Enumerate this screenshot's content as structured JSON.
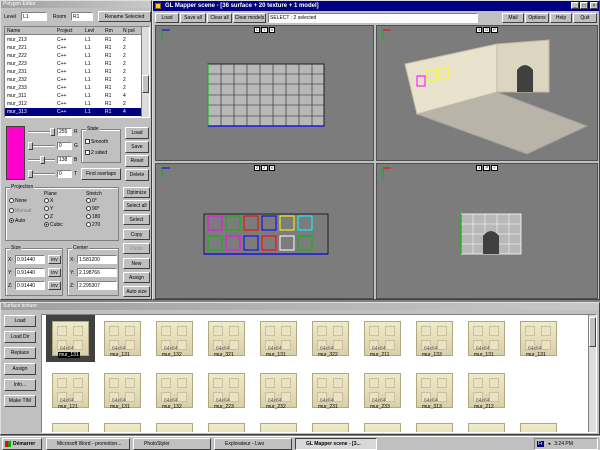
{
  "polygon_window": {
    "title": "Polygon Editor",
    "level_label": "Level",
    "level_value": "L1",
    "room_label": "Room",
    "room_value": "R1",
    "rename_button": "Rename Selected",
    "columns": [
      "Name",
      "Project",
      "Levl",
      "Rm",
      "N pol"
    ],
    "rows": [
      [
        "mur_213",
        "C++",
        "L1",
        "R1",
        "2"
      ],
      [
        "mur_221",
        "C++",
        "L1",
        "R1",
        "2"
      ],
      [
        "mur_222",
        "C++",
        "L1",
        "R1",
        "2"
      ],
      [
        "mur_223",
        "C++",
        "L1",
        "R1",
        "2"
      ],
      [
        "mur_231",
        "C++",
        "L1",
        "R1",
        "2"
      ],
      [
        "mur_232",
        "C++",
        "L1",
        "R1",
        "2"
      ],
      [
        "mur_233",
        "C++",
        "L1",
        "R1",
        "2"
      ],
      [
        "mur_311",
        "C++",
        "L1",
        "R1",
        "4"
      ],
      [
        "mur_312",
        "C++",
        "L1",
        "R1",
        "2"
      ],
      [
        "mur_313",
        "C++",
        "L1",
        "R1",
        "4"
      ]
    ],
    "selected_row_index": 9,
    "color_sliders": [
      {
        "value": "255",
        "channel": "R"
      },
      {
        "value": "0",
        "channel": "G"
      },
      {
        "value": "138",
        "channel": "B"
      },
      {
        "value": "0",
        "channel": "T"
      }
    ],
    "color_swatch": "#ff00cc",
    "state_group": "State",
    "smooth_label": "Smooth",
    "two_sided_label": "2 sided",
    "find_overlaps_button": "Find overlaps",
    "side_buttons": [
      "Load",
      "Save",
      "Reset",
      "Delete"
    ],
    "projection": {
      "title": "Projection",
      "options": [
        "None",
        "Manual",
        "Auto"
      ],
      "selected": "Auto",
      "plane_title": "Plane",
      "plane_options": [
        "X",
        "Y",
        "Z",
        "Cubic"
      ],
      "plane_selected": "Cubic",
      "stretch_title": "Stretch",
      "stretch_options": [
        "0°",
        "90°",
        "180",
        "270"
      ]
    },
    "optimize_buttons": [
      "Optimize",
      "Select all",
      "Select",
      "Copy",
      "Paste",
      "New",
      "Assign",
      "Auto size"
    ],
    "size": {
      "title": "Size",
      "x": "0.91440",
      "y": "0.91440",
      "z": "0.91440",
      "inv": "inv"
    },
    "center": {
      "title": "Center",
      "x": "1.581200",
      "y": "2.198766",
      "z": "2.295307"
    }
  },
  "scene_window": {
    "title": "GL Mapper scene - [36 surface + 20 texture + 1 model]",
    "toolbar": [
      "Load",
      "Save all",
      "Clear all",
      "Clear models"
    ],
    "status": "SELECT : 2 selected",
    "menu": [
      "Mail",
      "Options",
      "Help",
      "Quit"
    ],
    "viewports": [
      {
        "label": "1",
        "axis_a": "Y",
        "axis_b": "X"
      },
      {
        "label": "3",
        "axis_a": "D",
        "axis_b": "P"
      },
      {
        "label": "2",
        "axis_a": "Z",
        "axis_b": "X"
      },
      {
        "label": "4",
        "axis_a": "P",
        "axis_b": "Y"
      }
    ]
  },
  "surface_window": {
    "title": "Surface texture",
    "buttons": [
      "Load",
      "Load Dir",
      "Replace",
      "Assign",
      "Info...",
      "Make TIM"
    ],
    "row1": [
      {
        "size": "64x64",
        "name": "mur_131",
        "selected": true
      },
      {
        "size": "64x64",
        "name": "mur_131"
      },
      {
        "size": "64x64",
        "name": "mur_132"
      },
      {
        "size": "64x64",
        "name": "mur_321"
      },
      {
        "size": "64x64",
        "name": "mur_131"
      },
      {
        "size": "64x64",
        "name": "mur_322"
      },
      {
        "size": "64x64",
        "name": "mur_211"
      },
      {
        "size": "64x64",
        "name": "mur_133"
      },
      {
        "size": "64x64",
        "name": "mur_131"
      },
      {
        "size": "64x64",
        "name": "mur_131"
      }
    ],
    "row2": [
      {
        "size": "64x64",
        "name": "mur_121"
      },
      {
        "size": "64x64",
        "name": "mur_131"
      },
      {
        "size": "64x64",
        "name": "mur_132"
      },
      {
        "size": "64x64",
        "name": "mur_223"
      },
      {
        "size": "64x64",
        "name": "mur_232"
      },
      {
        "size": "64x64",
        "name": "mur_231"
      },
      {
        "size": "64x64",
        "name": "mur_233"
      },
      {
        "size": "64x64",
        "name": "mur_313"
      },
      {
        "size": "64x64",
        "name": "mur_212"
      }
    ]
  },
  "taskbar": {
    "start": "Démarrer",
    "items": [
      "Microsoft Word - promotion...",
      "PhotoStyler",
      "Explorateur - Lwo",
      "GL Mapper scene - [3..."
    ],
    "lang": "Fr",
    "clock": "3:24 PM"
  }
}
